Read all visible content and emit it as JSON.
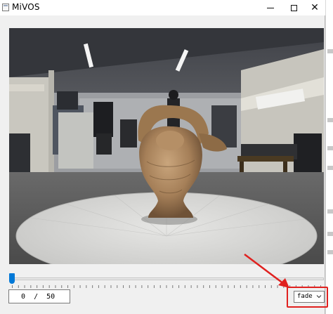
{
  "window": {
    "title": "MiVOS",
    "minimize_icon": "minimize-icon",
    "maximize_icon": "maximize-icon",
    "close_icon": "close-icon",
    "close_glyph": "✕"
  },
  "viewport": {
    "content": "photo of a carved ceramic figurine on a white turntable in an office"
  },
  "slider": {
    "current": 0,
    "max": 50,
    "position_fraction": 0.0
  },
  "frame_counter": {
    "text": "0 / 50"
  },
  "mode_dropdown": {
    "selected": "fade",
    "arrow_icon": "chevron-down-icon"
  },
  "annotation": {
    "color": "#e0211f",
    "arrow_icon": "red-arrow-icon"
  },
  "colors": {
    "slider_handle": "#0078d7",
    "background": "#f0f0f0"
  }
}
